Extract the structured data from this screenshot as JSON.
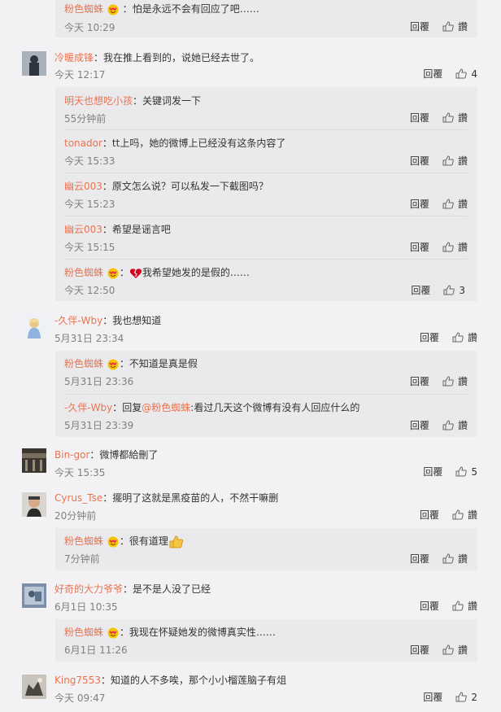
{
  "actions": {
    "reply": "回覆",
    "like": "讚"
  },
  "comments": [
    {
      "type": "sub",
      "user": "粉色蜘蛛",
      "text": "怕是永远不会有回应了吧……",
      "time": "今天 10:29",
      "likes": "讚"
    },
    {
      "type": "main",
      "user": "冷暖成锋",
      "text": "我在推上看到的，说她已经去世了。",
      "time": "今天 12:17",
      "likes": "4"
    },
    {
      "type": "sub",
      "user": "明天也想吃小孩",
      "text": "关键词发一下",
      "time": "55分钟前",
      "likes": "讚"
    },
    {
      "type": "sub",
      "user": "tonador",
      "text": "tt上吗，她的微博上已经没有这条内容了",
      "time": "今天 15:33",
      "likes": "讚"
    },
    {
      "type": "sub",
      "user": "幽云003",
      "text": "原文怎么说？可以私发一下截图吗？",
      "time": "今天 15:23",
      "likes": "讚"
    },
    {
      "type": "sub",
      "user": "幽云003",
      "text": "希望是谣言吧",
      "time": "今天 15:15",
      "likes": "讚"
    },
    {
      "type": "sub",
      "user": "粉色蜘蛛",
      "text": "我希望她发的是假的……",
      "time": "今天 12:50",
      "likes": "3"
    },
    {
      "type": "main",
      "user": "-久伴-Wby",
      "text": "我也想知道",
      "time": "5月31日 23:34",
      "likes": "讚"
    },
    {
      "type": "sub",
      "user": "粉色蜘蛛",
      "text": "不知道是真是假",
      "time": "5月31日 23:36",
      "likes": "讚"
    },
    {
      "type": "sub",
      "user": "-久伴-Wby",
      "reply_prefix": "回复",
      "reply_to": "@粉色蜘蛛",
      "text": ":看过几天这个微博有没有人回应什么的",
      "time": "5月31日 23:39",
      "likes": "讚"
    },
    {
      "type": "main",
      "user": "Bin-gor",
      "text": "微博都給刪了",
      "time": "今天 15:35",
      "likes": "5"
    },
    {
      "type": "main",
      "user": "Cyrus_Tse",
      "text": "擺明了这就是黑疫苗的人，不然干嘛删",
      "time": "20分钟前",
      "likes": "讚"
    },
    {
      "type": "sub",
      "user": "粉色蜘蛛",
      "text": "很有道理",
      "time": "7分钟前",
      "likes": "讚"
    },
    {
      "type": "main",
      "user": "好奇的大力爷爷",
      "text": "是不是人没了已经",
      "time": "6月1日 10:35",
      "likes": "讚"
    },
    {
      "type": "sub",
      "user": "粉色蜘蛛",
      "text": "我现在怀疑她发的微博真实性……",
      "time": "6月1日 11:26",
      "likes": "讚"
    },
    {
      "type": "main",
      "user": "King7553",
      "text": "知道的人不多唉，那个小小榴莲脑子有俎",
      "time": "今天 09:47",
      "likes": "2"
    }
  ],
  "colors": {
    "username": "#eb7350",
    "background": "#f2f2f5",
    "sub_background": "#eaeaec"
  }
}
